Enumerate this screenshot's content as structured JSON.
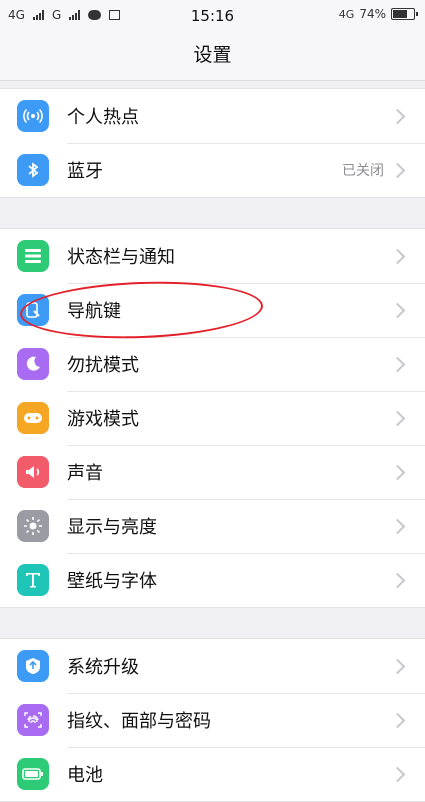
{
  "status_bar": {
    "sim1": "4G",
    "sim2": "G",
    "time": "15:16",
    "network": "4G",
    "battery_percent": "74%",
    "battery_level": 0.74
  },
  "header": {
    "title": "设置"
  },
  "groups": [
    [
      {
        "label": "个人热点",
        "icon": "hotspot-icon",
        "color": "#3d9af5"
      },
      {
        "label": "蓝牙",
        "icon": "bluetooth-icon",
        "color": "#3d9af5",
        "value": "已关闭"
      }
    ],
    [
      {
        "label": "状态栏与通知",
        "icon": "notification-icon",
        "color": "#2ecb76"
      },
      {
        "label": "导航键",
        "icon": "navigation-key-icon",
        "color": "#3d9af5"
      },
      {
        "label": "勿扰模式",
        "icon": "moon-icon",
        "color": "#a96bf2"
      },
      {
        "label": "游戏模式",
        "icon": "gamepad-icon",
        "color": "#f5a623"
      },
      {
        "label": "声音",
        "icon": "speaker-icon",
        "color": "#f25b6a"
      },
      {
        "label": "显示与亮度",
        "icon": "brightness-icon",
        "color": "#9b9ba3"
      },
      {
        "label": "壁纸与字体",
        "icon": "font-icon",
        "color": "#1fc6b8"
      }
    ],
    [
      {
        "label": "系统升级",
        "icon": "system-update-icon",
        "color": "#3d9af5"
      },
      {
        "label": "指纹、面部与密码",
        "icon": "fingerprint-icon",
        "color": "#a96bf2"
      },
      {
        "label": "电池",
        "icon": "battery-icon",
        "color": "#2ecb76"
      }
    ]
  ],
  "annotation": {
    "color": "#e4202a",
    "target": "导航键"
  }
}
